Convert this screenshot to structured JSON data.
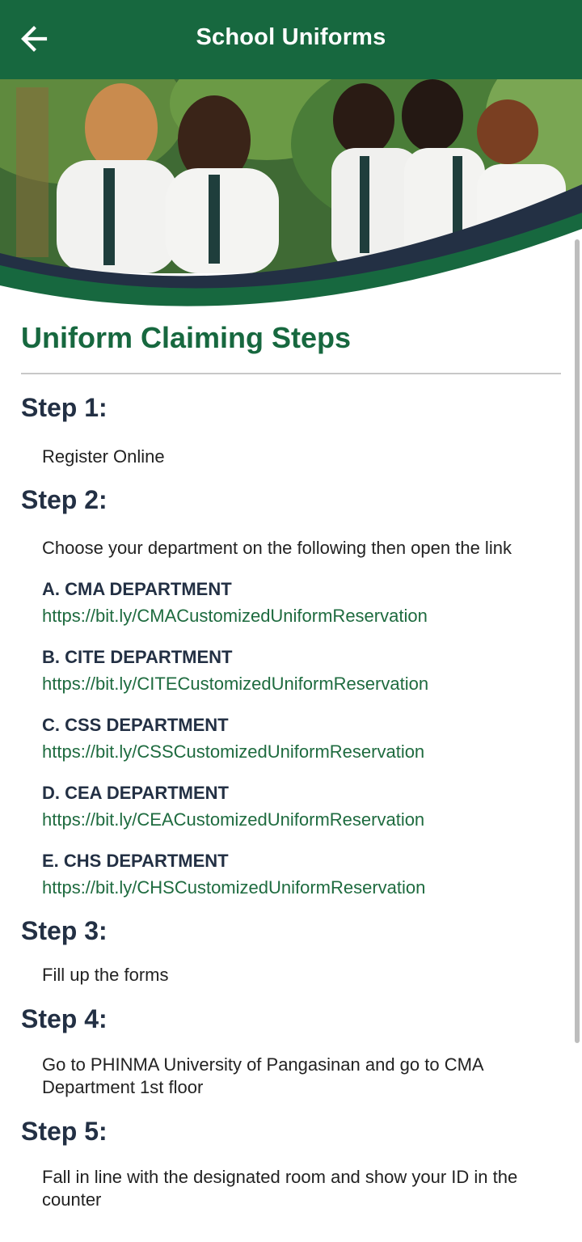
{
  "header": {
    "title": "School Uniforms"
  },
  "section_title": "Uniform Claiming Steps",
  "steps": [
    {
      "label": "Step 1:",
      "text": "Register Online"
    },
    {
      "label": "Step 2:",
      "text": "Choose your department on the following then open the link"
    },
    {
      "label": "Step 3:",
      "text": "Fill up the forms"
    },
    {
      "label": "Step 4:",
      "text": "Go to PHINMA University of Pangasinan and go to CMA Department 1st floor"
    },
    {
      "label": "Step 5:",
      "text": "Fall in line with the designated room and show your ID in the counter"
    }
  ],
  "departments": [
    {
      "name": "A. CMA DEPARTMENT",
      "link": "https://bit.ly/CMACustomizedUniformReservation"
    },
    {
      "name": "B. CITE DEPARTMENT",
      "link": "https://bit.ly/CITECustomizedUniformReservation"
    },
    {
      "name": "C. CSS DEPARTMENT",
      "link": "https://bit.ly/CSSCustomizedUniformReservation"
    },
    {
      "name": "D. CEA DEPARTMENT",
      "link": "https://bit.ly/CEACustomizedUniformReservation"
    },
    {
      "name": "E. CHS DEPARTMENT",
      "link": "https://bit.ly/CHSCustomizedUniformReservation"
    }
  ],
  "colors": {
    "brand_green": "#17683f",
    "navy": "#233044",
    "link_green": "#1e6b3f"
  },
  "icons": {
    "back": "arrow-left-icon"
  }
}
